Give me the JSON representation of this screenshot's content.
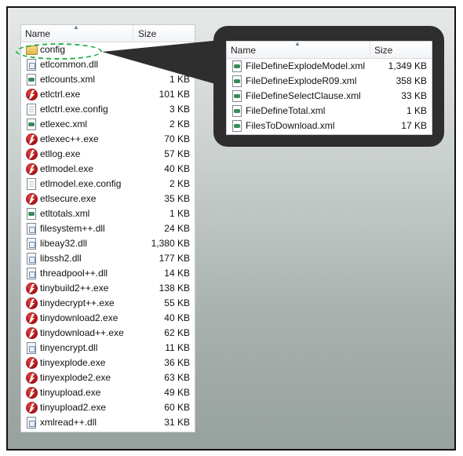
{
  "left_panel": {
    "columns": {
      "name": "Name",
      "size": "Size"
    },
    "files": [
      {
        "name": "config",
        "size": "",
        "icon": "folder-icon"
      },
      {
        "name": "etlcommon.dll",
        "size": "",
        "icon": "dll-icon"
      },
      {
        "name": "etlcounts.xml",
        "size": "1 KB",
        "icon": "xml-icon"
      },
      {
        "name": "etlctrl.exe",
        "size": "101 KB",
        "icon": "exe-icon"
      },
      {
        "name": "etlctrl.exe.config",
        "size": "3 KB",
        "icon": "document-icon"
      },
      {
        "name": "etlexec.xml",
        "size": "2 KB",
        "icon": "xml-icon"
      },
      {
        "name": "etlexec++.exe",
        "size": "70 KB",
        "icon": "exe-icon"
      },
      {
        "name": "etllog.exe",
        "size": "57 KB",
        "icon": "exe-icon"
      },
      {
        "name": "etlmodel.exe",
        "size": "40 KB",
        "icon": "exe-icon"
      },
      {
        "name": "etlmodel.exe.config",
        "size": "2 KB",
        "icon": "document-icon"
      },
      {
        "name": "etlsecure.exe",
        "size": "35 KB",
        "icon": "exe-icon"
      },
      {
        "name": "etltotals.xml",
        "size": "1 KB",
        "icon": "xml-icon"
      },
      {
        "name": "filesystem++.dll",
        "size": "24 KB",
        "icon": "dll-icon"
      },
      {
        "name": "libeay32.dll",
        "size": "1,380 KB",
        "icon": "dll-icon"
      },
      {
        "name": "libssh2.dll",
        "size": "177 KB",
        "icon": "dll-icon"
      },
      {
        "name": "threadpool++.dll",
        "size": "14 KB",
        "icon": "dll-icon"
      },
      {
        "name": "tinybuild2++.exe",
        "size": "138 KB",
        "icon": "exe-icon"
      },
      {
        "name": "tinydecrypt++.exe",
        "size": "55 KB",
        "icon": "exe-icon"
      },
      {
        "name": "tinydownload2.exe",
        "size": "40 KB",
        "icon": "exe-icon"
      },
      {
        "name": "tinydownload++.exe",
        "size": "62 KB",
        "icon": "exe-icon"
      },
      {
        "name": "tinyencrypt.dll",
        "size": "11 KB",
        "icon": "dll-icon"
      },
      {
        "name": "tinyexplode.exe",
        "size": "36 KB",
        "icon": "exe-icon"
      },
      {
        "name": "tinyexplode2.exe",
        "size": "63 KB",
        "icon": "exe-icon"
      },
      {
        "name": "tinyupload.exe",
        "size": "49 KB",
        "icon": "exe-icon"
      },
      {
        "name": "tinyupload2.exe",
        "size": "60 KB",
        "icon": "exe-icon"
      },
      {
        "name": "xmlread++.dll",
        "size": "31 KB",
        "icon": "dll-icon"
      }
    ]
  },
  "callout_panel": {
    "columns": {
      "name": "Name",
      "size": "Size"
    },
    "files": [
      {
        "name": "FileDefineExplodeModel.xml",
        "size": "1,349 KB",
        "icon": "xml-icon"
      },
      {
        "name": "FileDefineExplodeR09.xml",
        "size": "358 KB",
        "icon": "xml-icon"
      },
      {
        "name": "FileDefineSelectClause.xml",
        "size": "33 KB",
        "icon": "xml-icon"
      },
      {
        "name": "FileDefineTotal.xml",
        "size": "1 KB",
        "icon": "xml-icon"
      },
      {
        "name": "FilesToDownload.xml",
        "size": "17 KB",
        "icon": "xml-icon"
      }
    ]
  },
  "colors": {
    "highlight_ring": "#21b04b",
    "callout_bubble": "#2e2e2e",
    "exe_icon": "#b3161a"
  }
}
